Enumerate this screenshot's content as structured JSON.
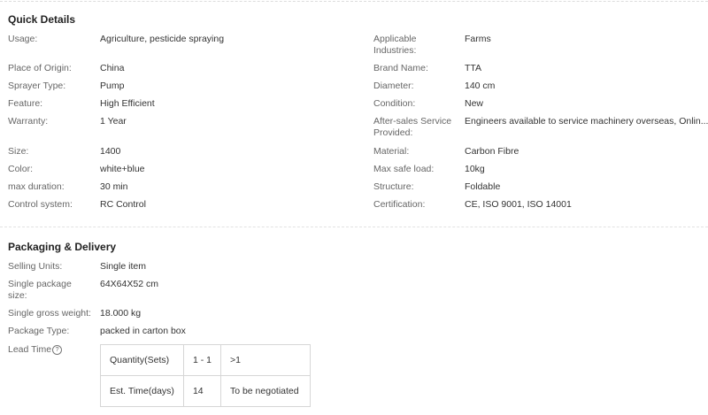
{
  "quick_details": {
    "title": "Quick Details",
    "left": [
      {
        "label": "Usage:",
        "value": "Agriculture, pesticide spraying"
      },
      {
        "label": "Place of Origin:",
        "value": "China"
      },
      {
        "label": "Sprayer Type:",
        "value": "Pump"
      },
      {
        "label": "Feature:",
        "value": "High Efficient"
      },
      {
        "label": "Warranty:",
        "value": "1 Year"
      },
      {
        "label": "Size:",
        "value": "1400"
      },
      {
        "label": "Color:",
        "value": "white+blue"
      },
      {
        "label": "max duration:",
        "value": "30 min"
      },
      {
        "label": "Control system:",
        "value": "RC Control"
      }
    ],
    "right": [
      {
        "label": "Applicable Industries:",
        "value": "Farms"
      },
      {
        "label": "Brand Name:",
        "value": "TTA"
      },
      {
        "label": "Diameter:",
        "value": "140 cm"
      },
      {
        "label": "Condition:",
        "value": "New"
      },
      {
        "label": "After-sales Service Provided:",
        "value": "Engineers available to service machinery overseas, Onlin..."
      },
      {
        "label": "Material:",
        "value": "Carbon Fibre"
      },
      {
        "label": "Max safe load:",
        "value": "10kg"
      },
      {
        "label": "Structure:",
        "value": "Foldable"
      },
      {
        "label": "Certification:",
        "value": "CE, ISO 9001, ISO 14001"
      }
    ]
  },
  "packaging": {
    "title": "Packaging & Delivery",
    "rows": [
      {
        "label": "Selling Units:",
        "value": "Single item"
      },
      {
        "label": "Single package size:",
        "value": "64X64X52 cm"
      },
      {
        "label": "Single gross weight:",
        "value": "18.000 kg"
      },
      {
        "label": "Package Type:",
        "value": "packed in carton box"
      }
    ],
    "lead_time_label": "Lead Time",
    "lead_table": {
      "row1": [
        "Quantity(Sets)",
        "1 - 1",
        ">1"
      ],
      "row2": [
        "Est. Time(days)",
        "14",
        "To be negotiated"
      ]
    }
  }
}
